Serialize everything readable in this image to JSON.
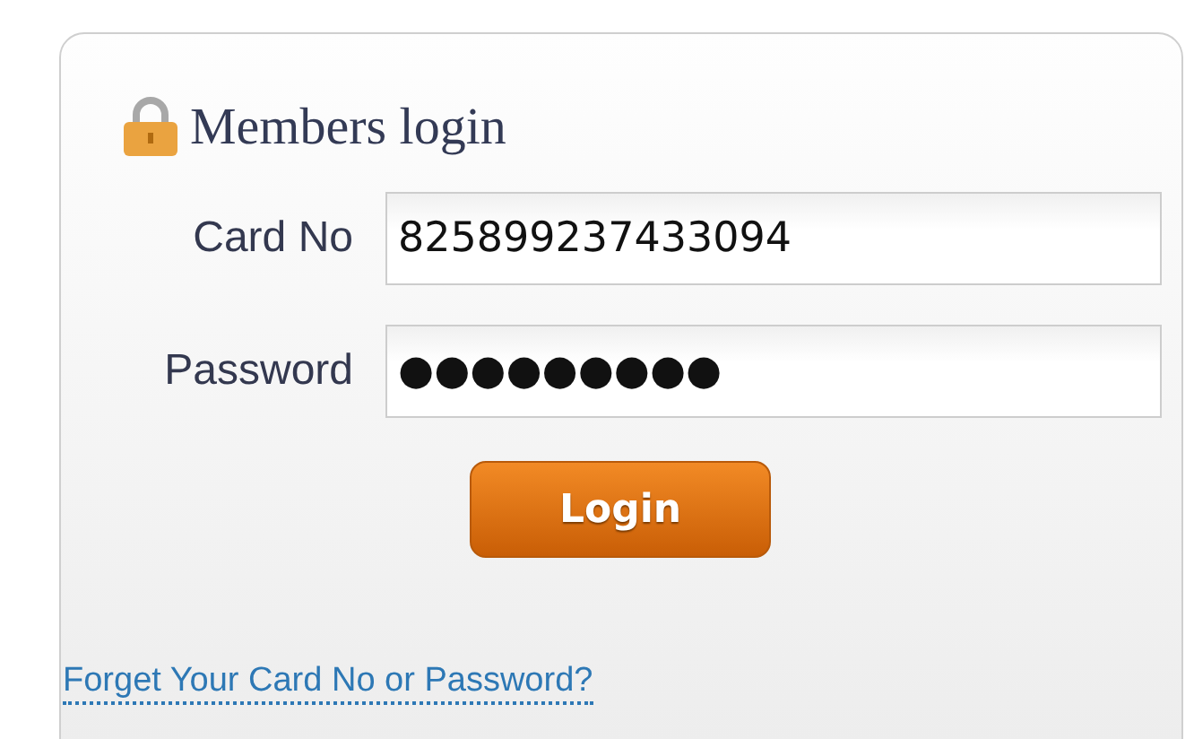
{
  "panel": {
    "title": "Members login"
  },
  "fields": [
    {
      "label": "Card No",
      "value": "825899237433094"
    },
    {
      "label": "Password",
      "value": "●●●●●●●●●"
    }
  ],
  "button": "Login",
  "link": "Forget Your Card No or Password?"
}
